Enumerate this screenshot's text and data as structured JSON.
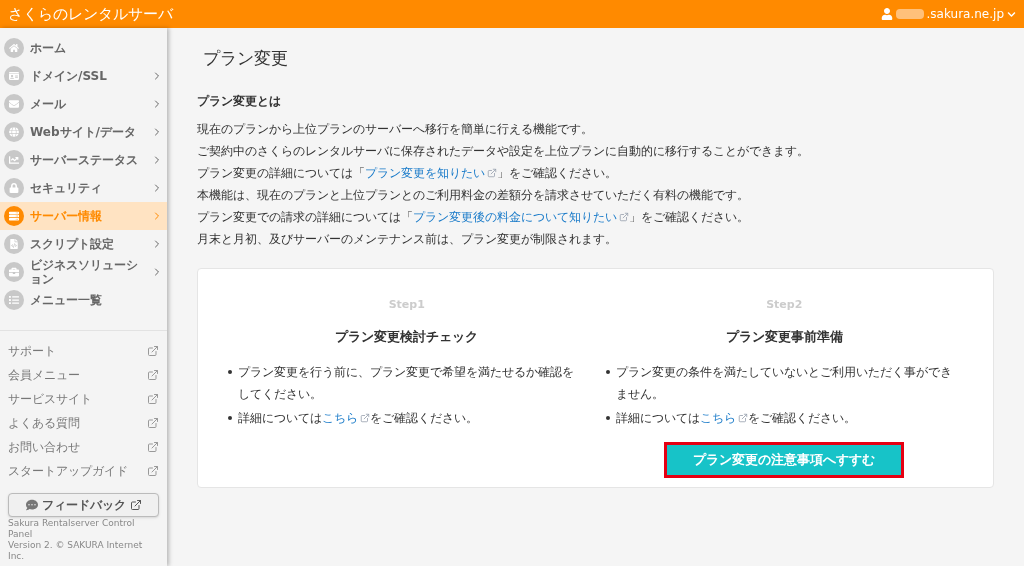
{
  "header": {
    "title": "さくらのレンタルサーバ",
    "account": ".sakura.ne.jp"
  },
  "nav": [
    {
      "label": "ホーム",
      "arrow": false,
      "selected": false
    },
    {
      "label": "ドメイン/SSL",
      "arrow": true,
      "selected": false
    },
    {
      "label": "メール",
      "arrow": true,
      "selected": false
    },
    {
      "label": "Webサイト/データ",
      "arrow": true,
      "selected": false
    },
    {
      "label": "サーバーステータス",
      "arrow": true,
      "selected": false
    },
    {
      "label": "セキュリティ",
      "arrow": true,
      "selected": false
    },
    {
      "label": "サーバー情報",
      "arrow": true,
      "selected": true
    },
    {
      "label": "スクリプト設定",
      "arrow": true,
      "selected": false
    },
    {
      "label": "ビジネスソリューション",
      "arrow": true,
      "selected": false
    },
    {
      "label": "メニュー一覧",
      "arrow": false,
      "selected": false
    }
  ],
  "links": [
    "サポート",
    "会員メニュー",
    "サービスサイト",
    "よくある質問",
    "お問い合わせ",
    "スタートアップガイド"
  ],
  "feedback": "フィードバック",
  "footer": [
    "Sakura Rentalserver Control Panel",
    "Version 2. © SAKURA Internet Inc."
  ],
  "page_title": "プラン変更",
  "section_title": "プラン変更とは",
  "paragraphs": [
    {
      "text": "現在のプランから上位プランのサーバーへ移行を簡単に行える機能です。"
    },
    {
      "text": "ご契約中のさくらのレンタルサーバに保存されたデータや設定を上位プランに自動的に移行することができます。"
    },
    {
      "text": "プラン変更の詳細については「",
      "link": "プラン変更を知りたい",
      "after": "」をご確認ください。"
    },
    {
      "text": "本機能は、現在のプランと上位プランとのご利用料金の差額分を請求させていただく有料の機能です。"
    },
    {
      "text": "プラン変更での請求の詳細については「",
      "link": "プラン変更後の料金について知りたい",
      "after": "」をご確認ください。"
    },
    {
      "text": "月末と月初、及びサーバーのメンテナンス前は、プラン変更が制限されます。"
    }
  ],
  "steps": [
    {
      "step": "Step1",
      "title": "プラン変更検討チェック",
      "bullets": [
        {
          "text": "プラン変更を行う前に、プラン変更で希望を満たせるか確認をしてください。"
        },
        {
          "text": "詳細については",
          "link": "こちら",
          "after": "をご確認ください。"
        }
      ]
    },
    {
      "step": "Step2",
      "title": "プラン変更事前準備",
      "bullets": [
        {
          "text": "プラン変更の条件を満たしていないとご利用いただく事ができません。"
        },
        {
          "text": "詳細については",
          "link": "こちら",
          "after": "をご確認ください。"
        }
      ],
      "button": {
        "label": "プラン変更の注意事項へすすむ",
        "highlighted": true
      }
    }
  ]
}
